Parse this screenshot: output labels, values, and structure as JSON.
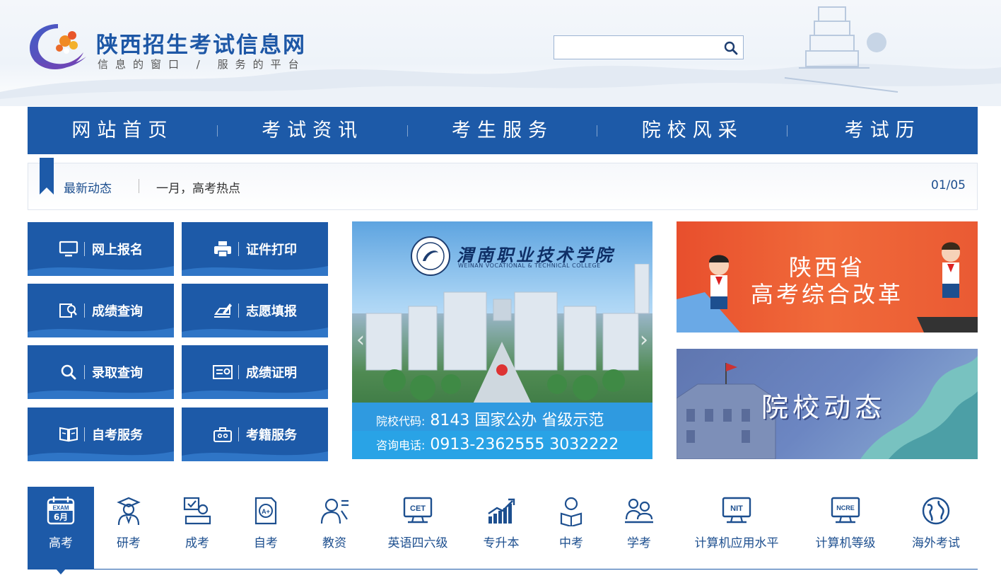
{
  "header": {
    "site_title": "陕西招生考试信息网",
    "slogan": "信息的窗口 / 服务的平台",
    "search": {
      "placeholder": "",
      "value": ""
    }
  },
  "nav": {
    "items": [
      {
        "label": "网站首页"
      },
      {
        "label": "考试资讯"
      },
      {
        "label": "考生服务"
      },
      {
        "label": "院校风采"
      },
      {
        "label": "考试历"
      }
    ]
  },
  "ticker": {
    "label": "最新动态",
    "text": "一月，高考热点",
    "counter": "01/05"
  },
  "services": [
    {
      "label": "网上报名",
      "icon": "monitor-icon"
    },
    {
      "label": "证件打印",
      "icon": "printer-icon"
    },
    {
      "label": "成绩查询",
      "icon": "score-search-icon"
    },
    {
      "label": "志愿填报",
      "icon": "pen-form-icon"
    },
    {
      "label": "录取查询",
      "icon": "search-icon"
    },
    {
      "label": "成绩证明",
      "icon": "certificate-icon"
    },
    {
      "label": "自考服务",
      "icon": "book-icon"
    },
    {
      "label": "考籍服务",
      "icon": "briefcase-icon"
    }
  ],
  "banner": {
    "college_name": "渭南职业技术学院",
    "college_en": "WEINAN VOCATIONAL & TECHNICAL COLLEGE",
    "line1_label": "院校代码:",
    "line1_value": "8143  国家公办  省级示范",
    "line2_label": "咨询电话:",
    "line2_value": "0913-2362555  3032222"
  },
  "promos": {
    "reform_line1": "陕西省",
    "reform_line2": "高考综合改革",
    "school_news": "院校动态"
  },
  "exam_tabs": [
    {
      "label": "高考",
      "icon": "calendar-exam-icon",
      "badge_top": "EXAM",
      "badge_bottom": "6月",
      "active": true
    },
    {
      "label": "研考",
      "icon": "graduate-icon"
    },
    {
      "label": "成考",
      "icon": "adult-learner-icon"
    },
    {
      "label": "自考",
      "icon": "grade-paper-icon"
    },
    {
      "label": "教资",
      "icon": "teacher-icon"
    },
    {
      "label": "英语四六级",
      "icon": "cet-icon",
      "badge": "CET"
    },
    {
      "label": "专升本",
      "icon": "growth-chart-icon"
    },
    {
      "label": "中考",
      "icon": "student-reading-icon"
    },
    {
      "label": "学考",
      "icon": "study-group-icon"
    },
    {
      "label": "计算机应用水平",
      "icon": "nit-icon",
      "badge": "NIT"
    },
    {
      "label": "计算机等级",
      "icon": "ncre-icon",
      "badge": "NCRE"
    },
    {
      "label": "海外考试",
      "icon": "globe-icon"
    }
  ],
  "colors": {
    "primary": "#1d5aa8",
    "reform_bg": "#e84f2d",
    "news_bg": "#6c86c2",
    "banner_band": "#2f9ae0"
  }
}
